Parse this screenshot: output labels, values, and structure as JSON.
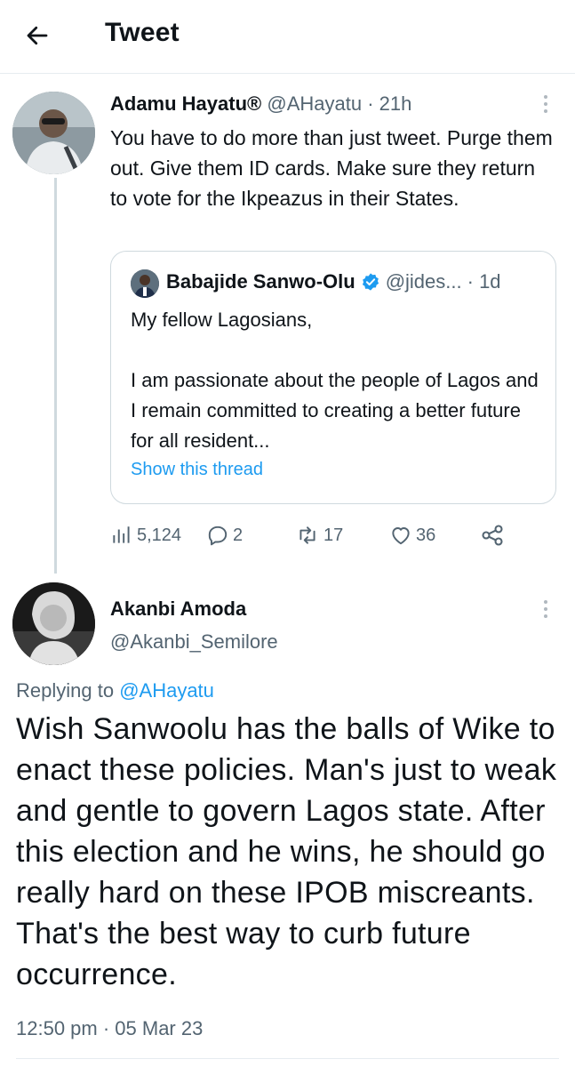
{
  "header": {
    "title": "Tweet"
  },
  "parent_tweet": {
    "author_name": "Adamu Hayatu®",
    "handle": "@AHayatu",
    "time": "· 21h",
    "text": "You have to do more than just tweet. Purge them out. Give them ID cards. Make sure they return to vote for the Ikpeazus in their States.",
    "quoted": {
      "author_name": "Babajide Sanwo-Olu",
      "verified": true,
      "handle": "@jides...",
      "time": "· 1d",
      "line1": "My fellow Lagosians,",
      "line2": "I am passionate about the people of Lagos and I remain committed to creating a better future for all resident...",
      "show_thread": "Show this thread"
    },
    "stats": {
      "views": "5,124",
      "replies": "2",
      "retweets": "17",
      "likes": "36"
    }
  },
  "reply_tweet": {
    "author_name": "Akanbi Amoda",
    "handle": "@Akanbi_Semilore",
    "replying_prefix": "Replying to ",
    "replying_to": "@AHayatu",
    "text": "Wish Sanwoolu has the balls of Wike to enact these policies. Man's just to weak and gentle to govern Lagos state. After this election and he wins, he should go really hard on these IPOB miscreants. That's the best way to curb future occurrence.",
    "timestamp": "12:50 pm · 05 Mar 23"
  },
  "colors": {
    "accent": "#1d9bf0",
    "muted": "#536471",
    "border": "#cfd9de",
    "text": "#0f1419"
  }
}
